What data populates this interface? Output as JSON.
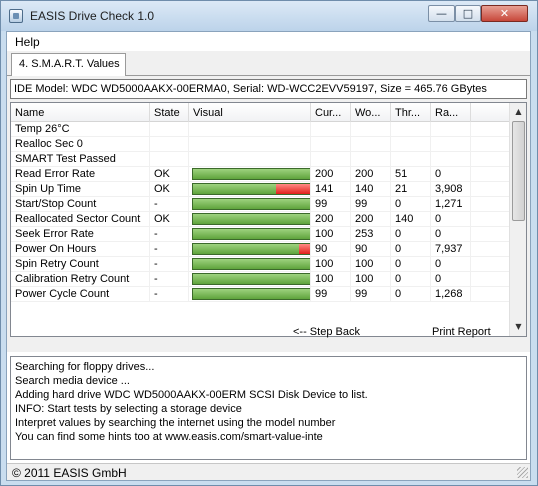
{
  "window": {
    "title": "EASIS Drive Check 1.0",
    "controls": {
      "minimize": "—",
      "maximize": "□",
      "close": "✕"
    }
  },
  "menu": {
    "items": [
      "Help"
    ]
  },
  "tabs": [
    {
      "label": "4. S.M.A.R.T. Values"
    }
  ],
  "model_info": "IDE Model: WDC WD5000AAKX-00ERMA0, Serial: WD-WCC2EVV59197, Size = 465.76 GBytes",
  "table": {
    "columns": [
      "Name",
      "State",
      "Visual",
      "Cur...",
      "Wo...",
      "Thr...",
      "Ra..."
    ],
    "rows": [
      {
        "name": "Temp 26°C",
        "state": "",
        "bar": null,
        "cur": "",
        "worst": "",
        "thr": "",
        "raw": ""
      },
      {
        "name": "Realloc Sec 0",
        "state": "",
        "bar": null,
        "cur": "",
        "worst": "",
        "thr": "",
        "raw": ""
      },
      {
        "name": "SMART Test Passed",
        "state": "",
        "bar": null,
        "cur": "",
        "worst": "",
        "thr": "",
        "raw": ""
      },
      {
        "name": "Read Error Rate",
        "state": "OK",
        "bar": 1.0,
        "cur": "200",
        "worst": "200",
        "thr": "51",
        "raw": "0"
      },
      {
        "name": "Spin Up Time",
        "state": "OK",
        "bar": 0.7,
        "cur": "141",
        "worst": "140",
        "thr": "21",
        "raw": "3,908"
      },
      {
        "name": "Start/Stop Count",
        "state": "-",
        "bar": 1.0,
        "cur": "99",
        "worst": "99",
        "thr": "0",
        "raw": "1,271"
      },
      {
        "name": "Reallocated Sector Count",
        "state": "OK",
        "bar": 1.0,
        "cur": "200",
        "worst": "200",
        "thr": "140",
        "raw": "0"
      },
      {
        "name": "Seek Error Rate",
        "state": "-",
        "bar": 1.0,
        "cur": "100",
        "worst": "253",
        "thr": "0",
        "raw": "0"
      },
      {
        "name": "Power On Hours",
        "state": "-",
        "bar": 0.9,
        "cur": "90",
        "worst": "90",
        "thr": "0",
        "raw": "7,937"
      },
      {
        "name": "Spin Retry Count",
        "state": "-",
        "bar": 1.0,
        "cur": "100",
        "worst": "100",
        "thr": "0",
        "raw": "0"
      },
      {
        "name": "Calibration Retry Count",
        "state": "-",
        "bar": 1.0,
        "cur": "100",
        "worst": "100",
        "thr": "0",
        "raw": "0"
      },
      {
        "name": "Power Cycle Count",
        "state": "-",
        "bar": 1.0,
        "cur": "99",
        "worst": "99",
        "thr": "0",
        "raw": "1,268"
      }
    ]
  },
  "links": {
    "back": "<-- Step Back",
    "print": "Print Report"
  },
  "log": [
    "Searching for floppy drives...",
    "Search media device ...",
    "Adding hard drive WDC WD5000AAKX-00ERM SCSI Disk Device to list.",
    "INFO: Start tests by selecting a storage device",
    "Interpret values by searching the internet using the model number",
    "You can find some hints too at www.easis.com/smart-value-inte"
  ],
  "status": "© 2011 EASIS GmbH",
  "colors": {
    "bar_green": "#7cc25a",
    "bar_red": "#e0201a",
    "title_bg": "#c9ddef"
  },
  "icons": {
    "app": "drive-check-app-icon",
    "scroll_up": "▲",
    "scroll_down": "▼"
  }
}
